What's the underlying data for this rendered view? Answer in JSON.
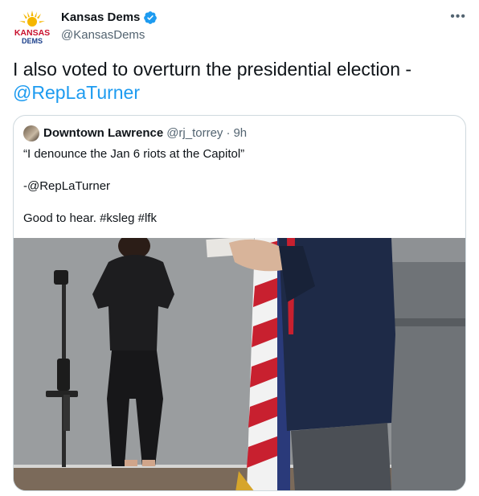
{
  "author": {
    "name": "Kansas Dems",
    "handle": "@KansasDems",
    "logo_text_top": "KANSAS",
    "logo_text_bottom": "DEMS",
    "verified_icon": "verified-badge-icon"
  },
  "more_icon": "more-options-icon",
  "tweet": {
    "text": "I also voted to overturn the presidential election - ",
    "mention": "@RepLaTurner"
  },
  "quote": {
    "name": "Downtown Lawrence",
    "handle": "@rj_torrey",
    "separator": "·",
    "time": "9h",
    "lines": [
      "“I denounce the Jan 6 riots at the Capitol”",
      "-@RepLaTurner",
      "Good to hear.  #ksleg #lfk"
    ]
  },
  "colors": {
    "link": "#1d9bf0",
    "text": "#0f1419",
    "secondary": "#536471",
    "border": "#cfd9de",
    "logo_red": "#c8102e",
    "logo_blue": "#1b3f8b",
    "logo_yellow": "#f5b700"
  }
}
